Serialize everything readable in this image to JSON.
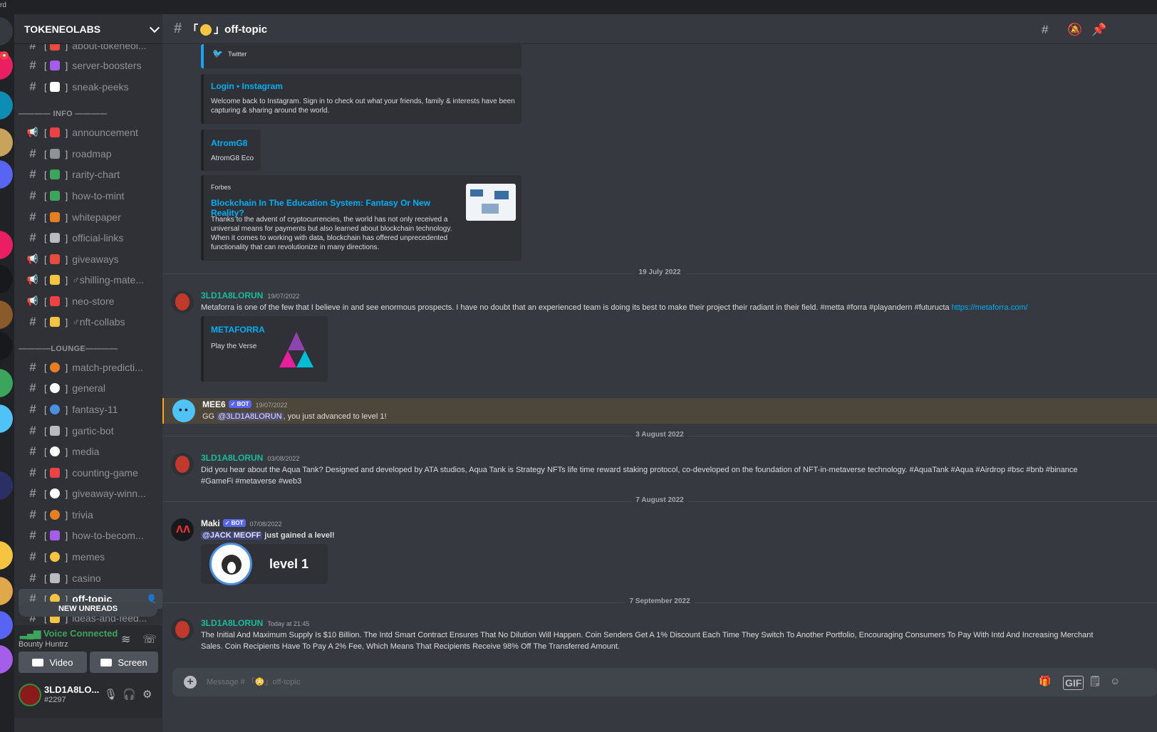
{
  "topbar": {
    "label": "rd"
  },
  "server": {
    "name": "TOKENEOLABS"
  },
  "channels_top": [
    {
      "name": "about-tokeneol...",
      "icon": "#",
      "emoji_color": "#e74c3c"
    },
    {
      "name": "server-boosters",
      "icon": "#",
      "emoji_color": "#a55eea"
    },
    {
      "name": "sneak-peeks",
      "icon": "#",
      "emoji_color": "#ffffff"
    }
  ],
  "category_info": "———— INFO ————",
  "channels_info": [
    {
      "name": "announcement",
      "icon": "📢",
      "emoji_color": "#ed4245"
    },
    {
      "name": "roadmap",
      "icon": "#",
      "emoji_color": "#8e9297"
    },
    {
      "name": "rarity-chart",
      "icon": "#",
      "emoji_color": "#3ba55d"
    },
    {
      "name": "how-to-mint",
      "icon": "#",
      "emoji_color": "#3ba55d"
    },
    {
      "name": "whitepaper",
      "icon": "#",
      "emoji_color": "#e67e22"
    },
    {
      "name": "official-links",
      "icon": "#",
      "emoji_color": "#b9bbbe"
    },
    {
      "name": "giveaways",
      "icon": "📢",
      "emoji_color": "#e74c3c"
    },
    {
      "name": "♂shilling-mate...",
      "icon": "📢",
      "emoji_color": "#f5c542"
    },
    {
      "name": "neo-store",
      "icon": "📢",
      "emoji_color": "#ed4245"
    },
    {
      "name": "♂nft-collabs",
      "icon": "#",
      "emoji_color": "#f5c542"
    }
  ],
  "category_lounge": "————LOUNGE————",
  "channels_lounge": [
    {
      "name": "match-predicti...",
      "icon": "#",
      "emoji_color": "#e67e22"
    },
    {
      "name": "general",
      "icon": "#",
      "emoji_color": "#ffffff"
    },
    {
      "name": "fantasy-11",
      "icon": "#",
      "emoji_color": "#4a90e2"
    },
    {
      "name": "gartic-bot",
      "icon": "#",
      "emoji_color": "#b9bbbe"
    },
    {
      "name": "media",
      "icon": "#",
      "emoji_color": "#ffffff"
    },
    {
      "name": "counting-game",
      "icon": "#",
      "emoji_color": "#ed4245"
    },
    {
      "name": "giveaway-winn...",
      "icon": "#",
      "emoji_color": "#ffffff"
    },
    {
      "name": "trivia",
      "icon": "#",
      "emoji_color": "#e67e22"
    },
    {
      "name": "how-to-becom...",
      "icon": "#",
      "emoji_color": "#a55eea"
    },
    {
      "name": "memes",
      "icon": "#",
      "emoji_color": "#f5c542"
    },
    {
      "name": "casino",
      "icon": "#",
      "emoji_color": "#b9bbbe"
    },
    {
      "name": "off-topic",
      "icon": "#",
      "emoji_color": "#f5c542"
    },
    {
      "name": "ideas-and-feed...",
      "icon": "#",
      "emoji_color": "#f5c542"
    }
  ],
  "new_unreads": "NEW UNREADS",
  "voice": {
    "status": "Voice Connected",
    "channel": "Bounty Huntrz",
    "video_label": "Video",
    "screen_label": "Screen"
  },
  "user": {
    "name": "3LD1A8LO...",
    "tag": "#2297"
  },
  "header": {
    "channel_name": "off-topic"
  },
  "embeds": {
    "twitter": {
      "provider": "Twitter"
    },
    "instagram": {
      "title": "Login • Instagram",
      "desc": "Welcome back to Instagram. Sign in to check out what your friends, family & interests have been capturing & sharing around the world."
    },
    "atrom": {
      "title": "AtromG8",
      "desc": "AtromG8 Eco"
    },
    "forbes": {
      "provider": "Forbes",
      "title": "Blockchain In The Education System: Fantasy Or New Reality?",
      "desc": "Thanks to the advent of cryptocurrencies, the world has not only received a universal means for payments but also learned about blockchain technology. When it comes to working with data, blockchain has offered unprecedented functionality that can revolutionize in many directions."
    },
    "metaforra": {
      "title": "METAFORRA",
      "desc": "Play the Verse"
    },
    "level_card": {
      "text": "level 1"
    }
  },
  "dividers": {
    "d1": "19 July 2022",
    "d2": "3 August 2022",
    "d3": "7 August 2022",
    "d4": "7 September 2022"
  },
  "messages": {
    "m1": {
      "author": "3LD1A8LORUN",
      "ts": "19/07/2022",
      "text": "Metaforra is one of the few that I believe in and see enormous prospects. I have no doubt that an experienced team is doing its best to make their project their radiant in their field. #metta #forra #playandern #futuructa ",
      "link": "https://metaforra.com/"
    },
    "m2": {
      "author": "MEE6",
      "bot": "✓ BOT",
      "ts": "19/07/2022",
      "pre": "GG ",
      "mention": "@3LD1A8LORUN",
      "post": ", you just advanced to level 1!"
    },
    "m3": {
      "author": "3LD1A8LORUN",
      "ts": "03/08/2022",
      "text": "Did you hear about the Aqua Tank? Designed and developed by ATA studios, Aqua Tank is Strategy NFTs life time reward staking protocol, co-developed on the foundation of NFT-in-metaverse technology. #AquaTank #Aqua #Airdrop #bsc #bnb #binance #GameFi #metaverse #web3"
    },
    "m4": {
      "author": "Maki",
      "bot": "✓ BOT",
      "ts": "07/08/2022",
      "mention": "@JACK MEOFF",
      "post": " just gained a level!"
    },
    "m5": {
      "author": "3LD1A8LORUN",
      "ts": "Today at 21:45",
      "text": "The Initial And Maximum Supply Is $10 Billion. The Intd Smart Contract Ensures That No Dilution Will Happen. Coin Senders Get A 1% Discount Each Time They Switch To Another Portfolio, Encouraging Consumers To Pay With Intd And Increasing Merchant Sales. Coin Recipients Have To Pay A 2% Fee, Which Means That Recipients Receive 98% Off The Transferred Amount."
    }
  },
  "composer": {
    "placeholder": "Message # 「😳」off-topic",
    "gif_label": "GIF"
  },
  "colors": {
    "accent": "#5865f2",
    "link": "#00aff4",
    "online": "#3ba55d",
    "author_green": "#1abc9c"
  }
}
